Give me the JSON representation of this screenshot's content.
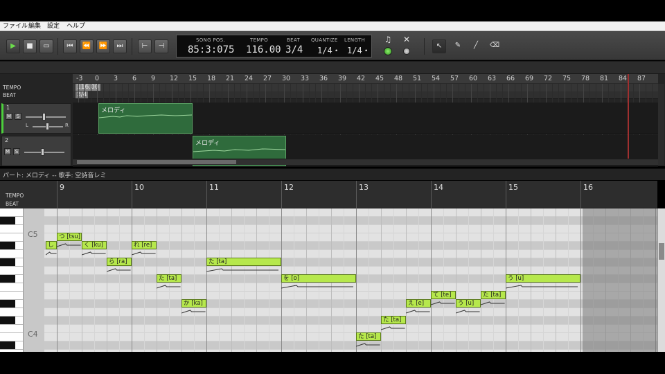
{
  "menu": [
    "ファイル",
    "編集",
    "設定",
    "ヘルプ"
  ],
  "transport": {
    "buttons": [
      "play-button",
      "stop-button",
      "loop-button",
      "goto-start-button",
      "rewind-button",
      "fast-forward-button",
      "goto-end-button",
      "marker-in-button",
      "marker-out-button"
    ]
  },
  "lcd": {
    "song_pos_label": "SONG POS.",
    "song_pos": "85:3:075",
    "tempo_label": "TEMPO",
    "tempo": "116.00",
    "beat_label": "BEAT",
    "beat": "3/4",
    "quantize_label": "QUANTIZE",
    "quantize": "1/4・",
    "length_label": "LENGTH",
    "length": "1/4・"
  },
  "arrange": {
    "ruler_ticks": [
      "-3",
      "0",
      "3",
      "6",
      "9",
      "12",
      "15",
      "18",
      "21",
      "24",
      "27",
      "30",
      "33",
      "36",
      "39",
      "42",
      "45",
      "48",
      "51",
      "54",
      "57",
      "60",
      "63",
      "66",
      "69",
      "72",
      "75",
      "78",
      "81",
      "84",
      "87"
    ],
    "tempo_label": "TEMPO",
    "beat_label": "BEAT",
    "tempo_value": "116.00",
    "beat_value": "3/4",
    "tracks": [
      {
        "number": "1",
        "clip_name": "メロディ",
        "mute": "M",
        "solo": "S",
        "pan_left": "L",
        "pan_right": "R"
      },
      {
        "number": "2",
        "clip_name": "メロディ",
        "mute": "M",
        "solo": "S"
      }
    ]
  },
  "roll": {
    "header": "パート: メロディ  --  歌手: 空詩音レミ",
    "tempo_label": "TEMPO",
    "beat_label": "BEAT",
    "bars": [
      "9",
      "10",
      "11",
      "12",
      "13",
      "14",
      "15",
      "16"
    ],
    "octave_labels": [
      "C5",
      "C4"
    ],
    "notes": [
      {
        "text": "し",
        "row": 4,
        "start": 0,
        "len": 0.55
      },
      {
        "text": "つ [tsu]",
        "row": 3,
        "start": 1,
        "len": 1
      },
      {
        "text": "く [ku]",
        "row": 4,
        "start": 2,
        "len": 1
      },
      {
        "text": "ら [ra]",
        "row": 6,
        "start": 3,
        "len": 1
      },
      {
        "text": "れ [re]",
        "row": 4,
        "start": 4,
        "len": 1
      },
      {
        "text": "た [ta]",
        "row": 8,
        "start": 5,
        "len": 1
      },
      {
        "text": "か [ka]",
        "row": 11,
        "start": 6,
        "len": 1
      },
      {
        "text": "た [ta]",
        "row": 6,
        "start": 7,
        "len": 3
      },
      {
        "text": "を [o]",
        "row": 8,
        "start": 10,
        "len": 3
      },
      {
        "text": "た [ta]",
        "row": 15,
        "start": 13,
        "len": 1
      },
      {
        "text": "た [ta]",
        "row": 13,
        "start": 14,
        "len": 1
      },
      {
        "text": "え [e]",
        "row": 11,
        "start": 15,
        "len": 1
      },
      {
        "text": "て [te]",
        "row": 10,
        "start": 16,
        "len": 1
      },
      {
        "text": "う [u]",
        "row": 11,
        "start": 17,
        "len": 1
      },
      {
        "text": "た [ta]",
        "row": 10,
        "start": 18,
        "len": 1
      },
      {
        "text": "う [u]",
        "row": 8,
        "start": 19,
        "len": 3
      }
    ]
  }
}
